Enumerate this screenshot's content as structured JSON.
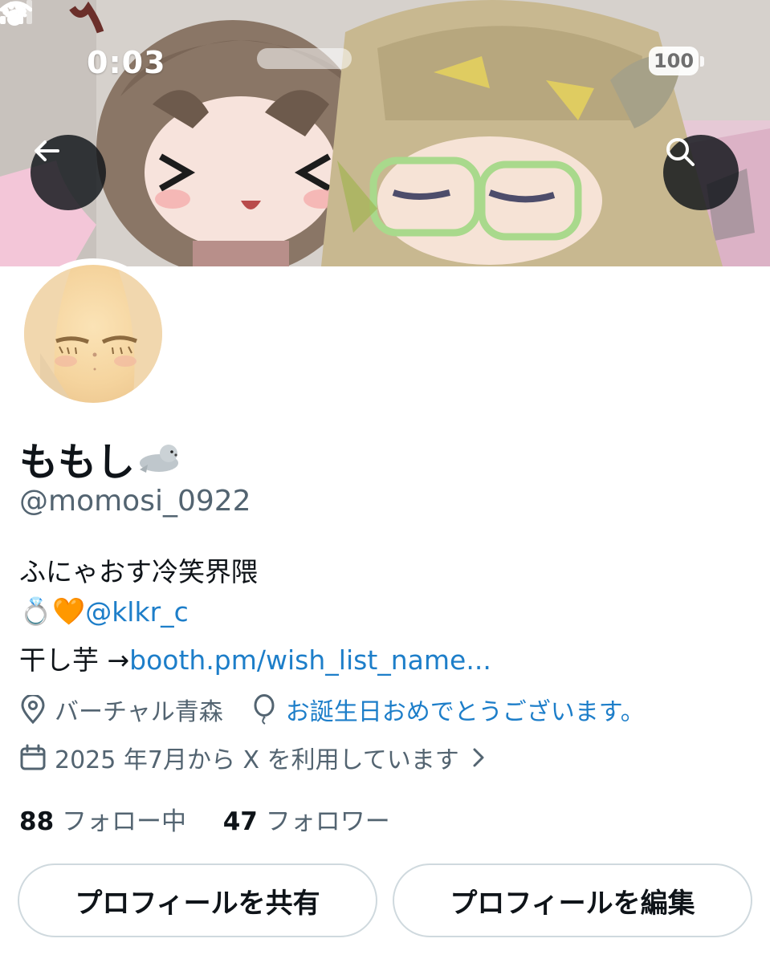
{
  "status_bar": {
    "time": "0:03",
    "battery": "100"
  },
  "profile": {
    "display_name": "ももし",
    "handle": "@momosi_0922",
    "bio": {
      "line1": "ふにゃおす冷笑界隈",
      "emoji": "💍🧡",
      "mention": "@klkr_c",
      "line3_prefix": "干し芋 →",
      "line3_link": "booth.pm/wish_list_name..."
    },
    "location": "バーチャル青森",
    "birthday": "お誕生日おめでとうございます。",
    "joined": "2025 年7月から X を利用しています"
  },
  "stats": {
    "following_count": "88",
    "following_label": "フォロー中",
    "followers_count": "47",
    "followers_label": "フォロワー"
  },
  "buttons": {
    "share": "プロフィールを共有",
    "edit": "プロフィールを編集"
  },
  "icons": [
    "paw-icon",
    "signal-icon",
    "wifi-icon",
    "back-arrow-icon",
    "search-icon",
    "seal-icon",
    "location-pin-icon",
    "balloon-icon",
    "calendar-icon",
    "chevron-right-icon"
  ],
  "colors": {
    "link": "#1d7ec9",
    "secondary_text": "#536471",
    "primary_text": "#0f1419"
  }
}
